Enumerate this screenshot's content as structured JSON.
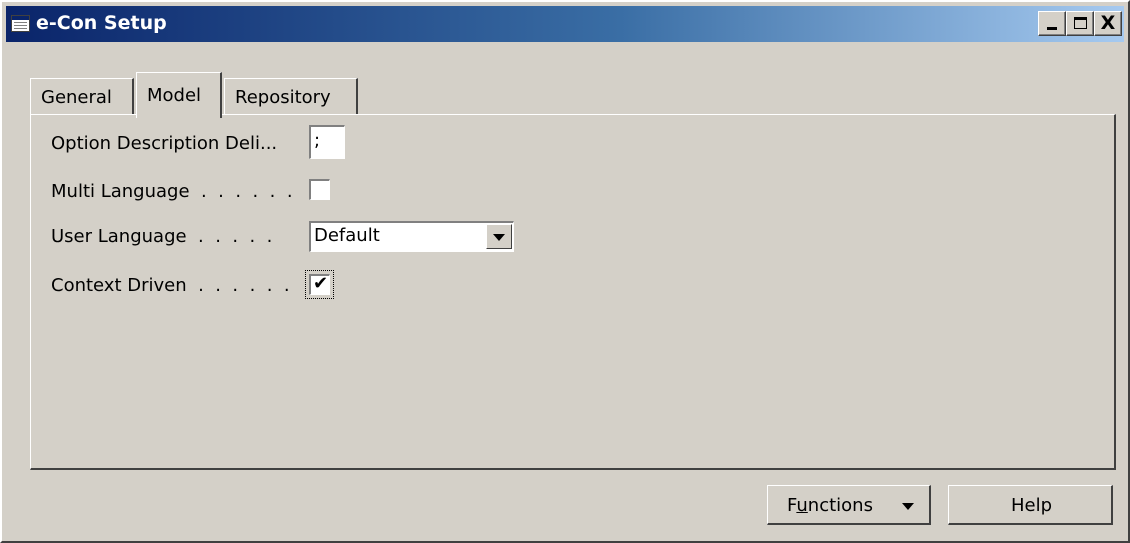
{
  "window": {
    "title": "e-Con Setup",
    "icons": {
      "app": "table-icon",
      "minimize": "minimize-icon",
      "maximize": "maximize-icon",
      "close": "close-icon"
    },
    "close_glyph": "X"
  },
  "tabs": [
    {
      "label": "General",
      "active": false
    },
    {
      "label": "Model",
      "active": true
    },
    {
      "label": "Repository",
      "active": false
    }
  ],
  "fields": {
    "option_description_delimiter": {
      "label": "Option Description Deli...",
      "value": ";"
    },
    "multi_language": {
      "label": "Multi Language  .  .  .  .  .  .",
      "checked": false
    },
    "user_language": {
      "label": "User Language  .  .  .  .  .",
      "value": "Default",
      "icon": "chevron-down-icon"
    },
    "context_driven": {
      "label": "Context Driven  .  .  .  .  .  .",
      "checked": true,
      "mark": "✔"
    }
  },
  "buttons": {
    "functions": {
      "label_pre": "F",
      "label_underline": "u",
      "label_post": "nctions",
      "icon": "chevron-down-icon"
    },
    "help": {
      "label": "Help"
    }
  },
  "colors": {
    "titlebar_start": "#0a246a",
    "titlebar_end": "#a6caf0",
    "face": "#d4d0c8"
  }
}
